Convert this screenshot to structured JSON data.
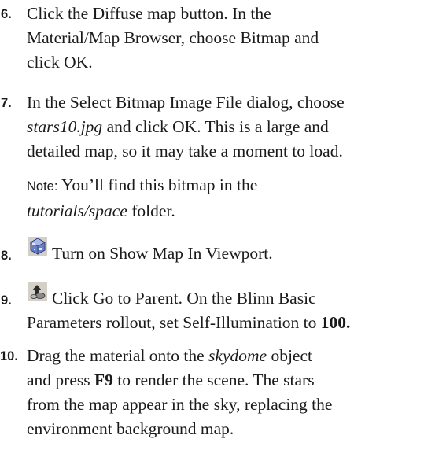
{
  "steps": [
    {
      "number": "6.",
      "lines": [
        "Click the Diffuse map button.  In the",
        "Material/Map Browser, choose Bitmap and",
        "click OK."
      ]
    },
    {
      "number": "7.",
      "line1_pre": "In the Select Bitmap Image File dialog, choose",
      "line2_italic": "stars10.jpg",
      "line2_post": " and click OK. This is a large and",
      "line3": "detailed map, so it may take a moment to load."
    },
    {
      "note_label": "Note:",
      "note_text": " You’ll find this bitmap in the",
      "note_italic": "tutorials/space",
      "note_post": " folder."
    },
    {
      "number": "8.",
      "icon": "show-map-in-viewport-icon",
      "text": "Turn on Show Map In Viewport."
    },
    {
      "number": "9.",
      "icon": "go-to-parent-icon",
      "line1": "Click Go to Parent. On the Blinn Basic",
      "line2_pre": "Parameters rollout, set Self-Illumination to ",
      "line2_bold": "100."
    },
    {
      "number": "10.",
      "line1_pre": "Drag the material onto the ",
      "line1_italic": "skydome",
      "line1_post": " object",
      "line2_pre": "and press ",
      "line2_bold": "F9",
      "line2_post": " to render the scene.  The stars",
      "line3": "from the map appear in the sky, replacing the",
      "line4": "environment background map."
    }
  ],
  "colors": {
    "text": "#1a1a1a",
    "background": "#ffffff"
  }
}
